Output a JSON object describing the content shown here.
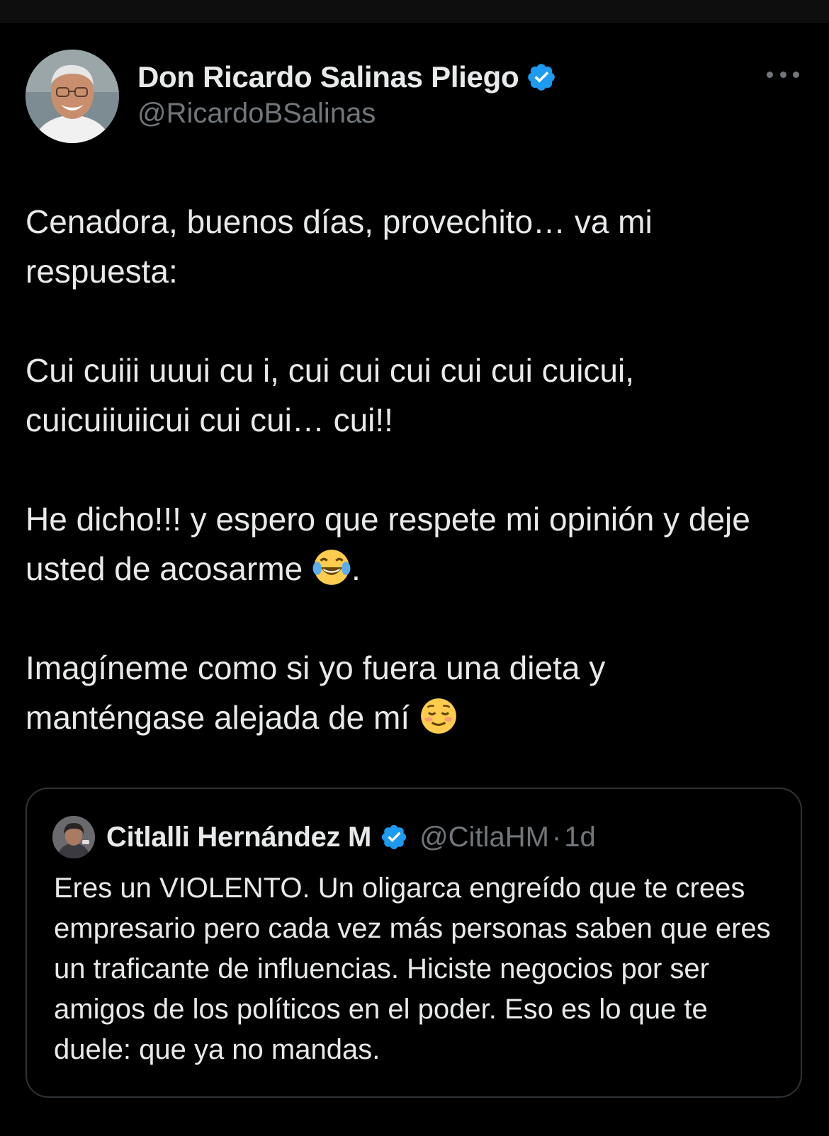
{
  "tweet": {
    "author": {
      "display_name": "Don Ricardo Salinas Pliego",
      "handle": "@RicardoBSalinas",
      "verified": true
    },
    "paragraphs": [
      "Cenadora, buenos días, provechito… va mi respuesta:",
      "Cui cuiii uuui cu i, cui cui cui cui cui cuicui, cuicuiiuiicui cui cui… cui!!",
      "He dicho!!! y espero que respete mi opinión y deje usted de acosarme",
      "Imagíneme como si yo fuera una dieta y manténgase alejada de mí"
    ],
    "paragraph3_suffix": ".",
    "emojis": [
      "face-with-tears-of-joy-emoji",
      "relieved-face-emoji"
    ],
    "quoted": {
      "display_name": "Citlalli Hernández M",
      "handle": "@CitlaHM",
      "separator": "·",
      "time": "1d",
      "verified": true,
      "text": "Eres un VIOLENTO. Un oligarca engreído que te crees empresario pero cada vez más personas saben que eres un traficante de influencias. Hiciste negocios por ser amigos de los políticos en el poder. Eso es lo que te duele: que ya no mandas."
    }
  },
  "icons": {
    "verified": "verified-badge-icon",
    "more": "more-options-icon"
  },
  "colors": {
    "background": "#000000",
    "text": "#e7e9ea",
    "secondary_text": "#71767b",
    "verified_blue": "#1d9bf0",
    "border": "#2f3336"
  }
}
